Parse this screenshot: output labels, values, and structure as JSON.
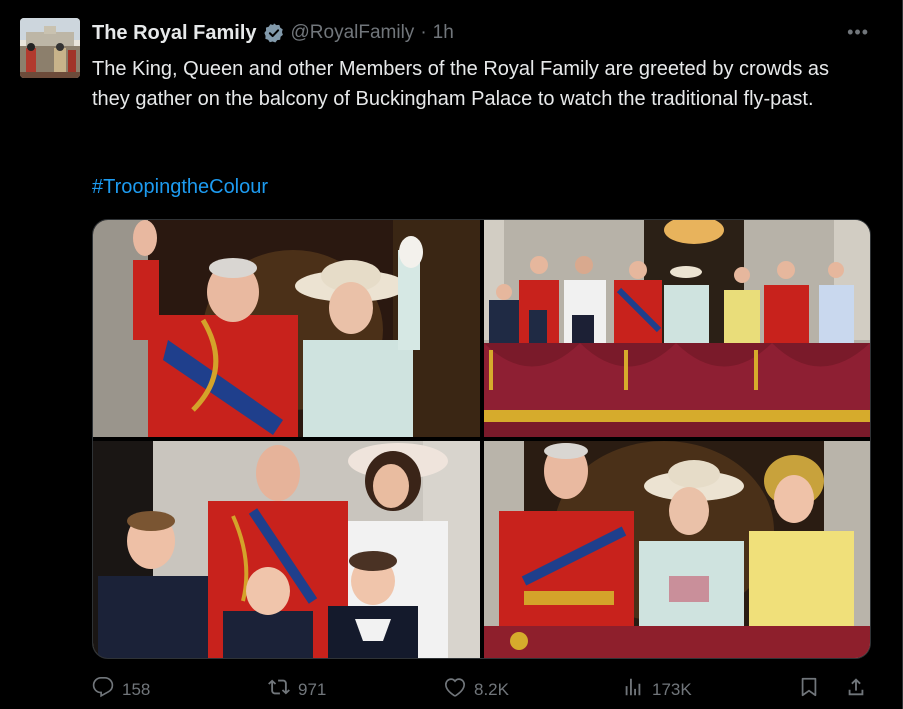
{
  "author": {
    "name": "The Royal Family",
    "handle": "@RoyalFamily",
    "separator": "·",
    "time": "1h"
  },
  "more_label": "•••",
  "body_text": "The King, Queen and other Members of the Royal Family are greeted by crowds as they gather on the balcony of Buckingham Palace to watch the traditional fly-past.",
  "hashtag": "#TroopingtheColour",
  "actions": {
    "replies": "158",
    "reposts": "971",
    "likes": "8.2K",
    "views": "173K"
  },
  "colors": {
    "link": "#1d9bf0",
    "muted": "#71767b",
    "verified": "#829aab"
  },
  "icons": [
    "reply-icon",
    "repost-icon",
    "like-icon",
    "views-icon",
    "bookmark-icon",
    "share-icon",
    "verified-badge-icon",
    "more-icon"
  ]
}
